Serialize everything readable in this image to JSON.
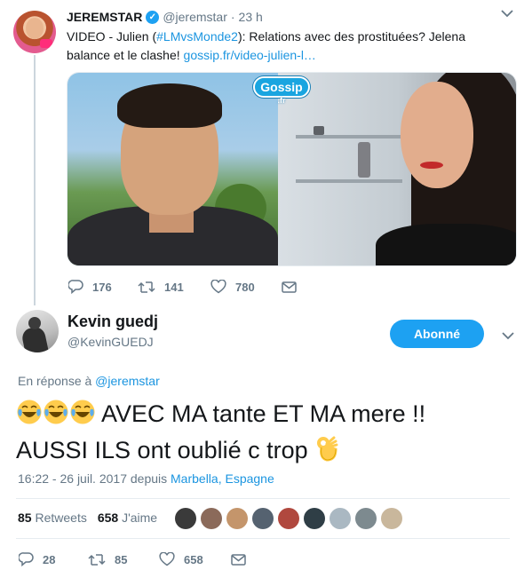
{
  "parent_tweet": {
    "name": "JEREMSTAR",
    "verified_mark": "✓",
    "handle": "@jeremstar",
    "separator": "·",
    "time": "23 h",
    "text_plain_1": "VIDEO - Julien (",
    "hashtag": "#LMvsMonde2",
    "text_plain_2": "): Relations avec des prostituées? Jelena balance et le clashe! ",
    "link": "gossip.fr/video-julien-l…",
    "media_watermark": "Gossip",
    "media_watermark_sub": ".fr",
    "replies": "176",
    "retweets": "141",
    "likes": "780"
  },
  "main_tweet": {
    "name": "Kevin guedj",
    "handle": "@KevinGUEDJ",
    "follow_label": "Abonné",
    "reply_prefix": "En réponse à ",
    "reply_target": "@jeremstar",
    "text_line_1": "AVEC MA tante ET MA mere !!",
    "text_line_2": "AUSSI ILS ont oublié c trop",
    "timestamp": "16:22 - 26 juil. 2017 depuis ",
    "location": "Marbella, Espagne",
    "retweets_count": "85",
    "retweets_label": "Retweets",
    "likes_count": "658",
    "likes_label": "J'aime",
    "replies": "28",
    "retweets": "85",
    "likes": "658"
  },
  "icons": {
    "reply": "reply-icon",
    "retweet": "retweet-icon",
    "like": "heart-icon",
    "dm": "envelope-icon",
    "caret": "chevron-down-icon",
    "tears_of_joy": "face-with-tears-of-joy-emoji",
    "ok_hand": "ok-hand-emoji"
  },
  "colors": {
    "accent": "#1da1f2",
    "link": "#1b95e0",
    "text": "#14171a",
    "secondary": "#657786",
    "divider": "#e6ecf0",
    "thread_line": "#ccd6dd"
  },
  "likers": [
    {
      "color": "#3a3a3a"
    },
    {
      "color": "#8b6a5a"
    },
    {
      "color": "#c4956b"
    },
    {
      "color": "#556270"
    },
    {
      "color": "#b0483e"
    },
    {
      "color": "#2f3e46"
    },
    {
      "color": "#aab8c2"
    },
    {
      "color": "#7d8a8f"
    },
    {
      "color": "#c9b79c"
    }
  ]
}
